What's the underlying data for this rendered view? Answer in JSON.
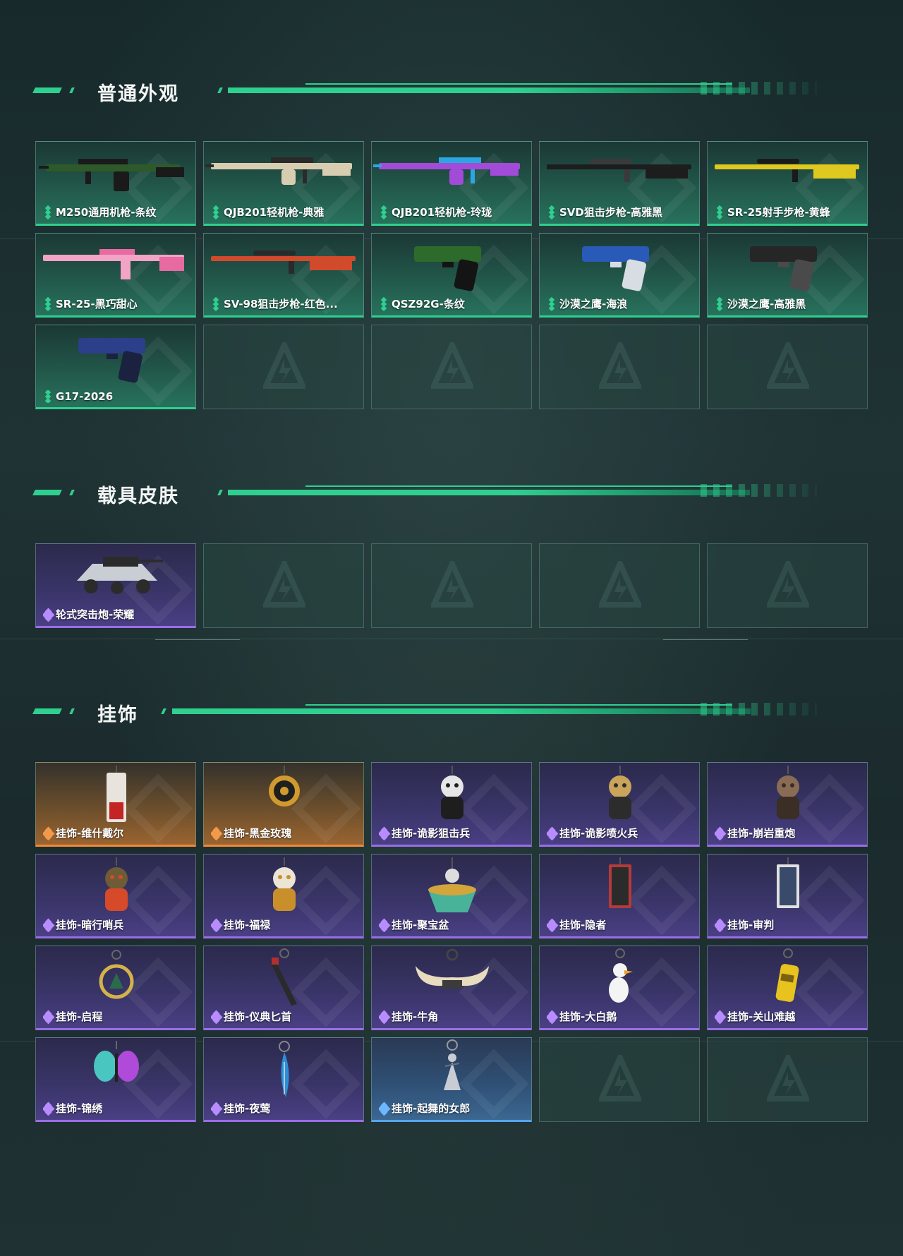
{
  "sections": [
    {
      "title": "普通外观",
      "items": [
        {
          "label": "M250通用机枪-条纹",
          "rarity": "green",
          "art": "rifle",
          "c1": "#2e5a2a",
          "c2": "#1a1a1a"
        },
        {
          "label": "QJB201轻机枪-典雅",
          "rarity": "green",
          "art": "lmg",
          "c1": "#d8cdb0",
          "c2": "#2a2a2a"
        },
        {
          "label": "QJB201轻机枪-玲珑",
          "rarity": "green",
          "art": "lmg",
          "c1": "#a24bd8",
          "c2": "#2aa7e0"
        },
        {
          "label": "SVD狙击步枪-高雅黑",
          "rarity": "green",
          "art": "sniper",
          "c1": "#1d1d1d",
          "c2": "#3a3a3a"
        },
        {
          "label": "SR-25射手步枪-黄蜂",
          "rarity": "green",
          "art": "sniper",
          "c1": "#e0c91e",
          "c2": "#1a1a1a"
        },
        {
          "label": "SR-25-黑巧甜心",
          "rarity": "green",
          "art": "ar",
          "c1": "#f2a3c6",
          "c2": "#e76ba0"
        },
        {
          "label": "SV-98狙击步枪-红色...",
          "rarity": "green",
          "art": "sniper",
          "c1": "#d14a2c",
          "c2": "#2a2a2a"
        },
        {
          "label": "QSZ92G-条纹",
          "rarity": "green",
          "art": "pistol",
          "c1": "#2c6b2c",
          "c2": "#141414"
        },
        {
          "label": "沙漠之鹰-海浪",
          "rarity": "green",
          "art": "pistol",
          "c1": "#2a5ab8",
          "c2": "#d8dde3"
        },
        {
          "label": "沙漠之鹰-高雅黑",
          "rarity": "green",
          "art": "pistol",
          "c1": "#262626",
          "c2": "#4a4a4a"
        },
        {
          "label": "G17-2026",
          "rarity": "green",
          "art": "pistol",
          "c1": "#2b3f8a",
          "c2": "#1a2240"
        },
        {
          "label": "",
          "rarity": "empty"
        },
        {
          "label": "",
          "rarity": "empty"
        },
        {
          "label": "",
          "rarity": "empty"
        },
        {
          "label": "",
          "rarity": "empty"
        }
      ]
    },
    {
      "title": "载具皮肤",
      "items": [
        {
          "label": "轮式突击炮-荣耀",
          "rarity": "purple",
          "art": "vehicle",
          "c1": "#c9ced4",
          "c2": "#2b2b2b"
        },
        {
          "label": "",
          "rarity": "empty"
        },
        {
          "label": "",
          "rarity": "empty"
        },
        {
          "label": "",
          "rarity": "empty"
        },
        {
          "label": "",
          "rarity": "empty"
        }
      ]
    },
    {
      "title": "挂饰",
      "items": [
        {
          "label": "挂饰-维什戴尔",
          "rarity": "orange",
          "art": "tag",
          "c1": "#e8e3dc",
          "c2": "#c32424"
        },
        {
          "label": "挂饰-黑金玫瑰",
          "rarity": "orange",
          "art": "medal",
          "c1": "#1f1f1f",
          "c2": "#d19a2e"
        },
        {
          "label": "挂饰-诡影狙击兵",
          "rarity": "purple",
          "art": "figure",
          "c1": "#e6e6e6",
          "c2": "#1e1e1e"
        },
        {
          "label": "挂饰-诡影喷火兵",
          "rarity": "purple",
          "art": "figure",
          "c1": "#caa45a",
          "c2": "#2c2c2c"
        },
        {
          "label": "挂饰-崩岩重炮",
          "rarity": "purple",
          "art": "figure",
          "c1": "#8a6c55",
          "c2": "#3a2e25"
        },
        {
          "label": "挂饰-暗行哨兵",
          "rarity": "purple",
          "art": "figure",
          "c1": "#6d5c36",
          "c2": "#d64a2a"
        },
        {
          "label": "挂饰-福禄",
          "rarity": "purple",
          "art": "figure",
          "c1": "#ece4d4",
          "c2": "#c98f2a"
        },
        {
          "label": "挂饰-聚宝盆",
          "rarity": "purple",
          "art": "bowl",
          "c1": "#49b39a",
          "c2": "#d3a53a"
        },
        {
          "label": "挂饰-隐者",
          "rarity": "purple",
          "art": "card",
          "c1": "#2b2b2b",
          "c2": "#b53a3a"
        },
        {
          "label": "挂饰-审判",
          "rarity": "purple",
          "art": "card",
          "c1": "#3a4a6a",
          "c2": "#e0e0e0"
        },
        {
          "label": "挂饰-启程",
          "rarity": "purple",
          "art": "ring",
          "c1": "#d4b24a",
          "c2": "#2c6b4a"
        },
        {
          "label": "挂饰-仪典匕首",
          "rarity": "purple",
          "art": "dagger",
          "c1": "#2a2a2a",
          "c2": "#b03030"
        },
        {
          "label": "挂饰-牛角",
          "rarity": "purple",
          "art": "horns",
          "c1": "#e8dcc0",
          "c2": "#3b3b3b"
        },
        {
          "label": "挂饰-大白鹅",
          "rarity": "purple",
          "art": "goose",
          "c1": "#f4f4f4",
          "c2": "#f0a020"
        },
        {
          "label": "挂饰-关山难越",
          "rarity": "purple",
          "art": "can",
          "c1": "#e8c21e",
          "c2": "#7a6212"
        },
        {
          "label": "挂饰-锦绣",
          "rarity": "purple",
          "art": "butterfly",
          "c1": "#4ac6c0",
          "c2": "#b04ad8"
        },
        {
          "label": "挂饰-夜莺",
          "rarity": "purple",
          "art": "feather",
          "c1": "#2b8fd8",
          "c2": "#e0e0e0"
        },
        {
          "label": "挂饰-起舞的女郎",
          "rarity": "blue",
          "art": "dancer",
          "c1": "#c8cdd4",
          "c2": "#6b7280"
        },
        {
          "label": "",
          "rarity": "empty"
        },
        {
          "label": "",
          "rarity": "empty"
        }
      ]
    }
  ],
  "colors": {
    "accent_green": "#2fd08f",
    "rarity_green": "#2fd08f",
    "rarity_purple": "#9a6ee8",
    "rarity_orange": "#f0893a",
    "rarity_blue": "#55a7ee"
  }
}
